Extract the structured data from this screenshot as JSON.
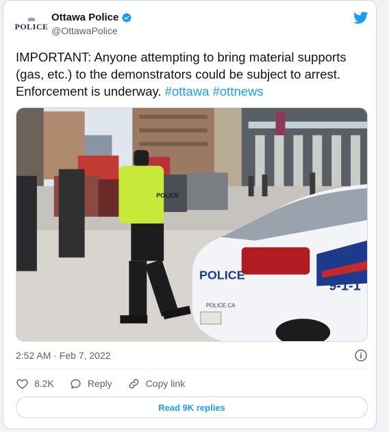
{
  "account": {
    "logo_text": "POLICE",
    "display_name": "Ottawa Police",
    "handle": "@OttawaPolice"
  },
  "tweet": {
    "text": "IMPORTANT: Anyone attempting to bring material supports (gas, etc.) to the demonstrators could be subject to arrest. Enforcement is underway.",
    "hashtags": [
      "#ottawa",
      "#ottnews"
    ],
    "timestamp": "2:52 AM · Feb 7, 2022"
  },
  "media": {
    "car_text": "POLICE",
    "car_number": "9-1-1",
    "plate_text": "POLICE.CA",
    "vest_text": "POLICE"
  },
  "actions": {
    "likes": "8.2K",
    "reply_label": "Reply",
    "copy_label": "Copy link"
  },
  "footer": {
    "read_replies_label": "Read 9K replies"
  },
  "colors": {
    "accent": "#1d9bf0",
    "text": "#0f1419",
    "muted": "#536471",
    "border": "#cfd9de"
  }
}
